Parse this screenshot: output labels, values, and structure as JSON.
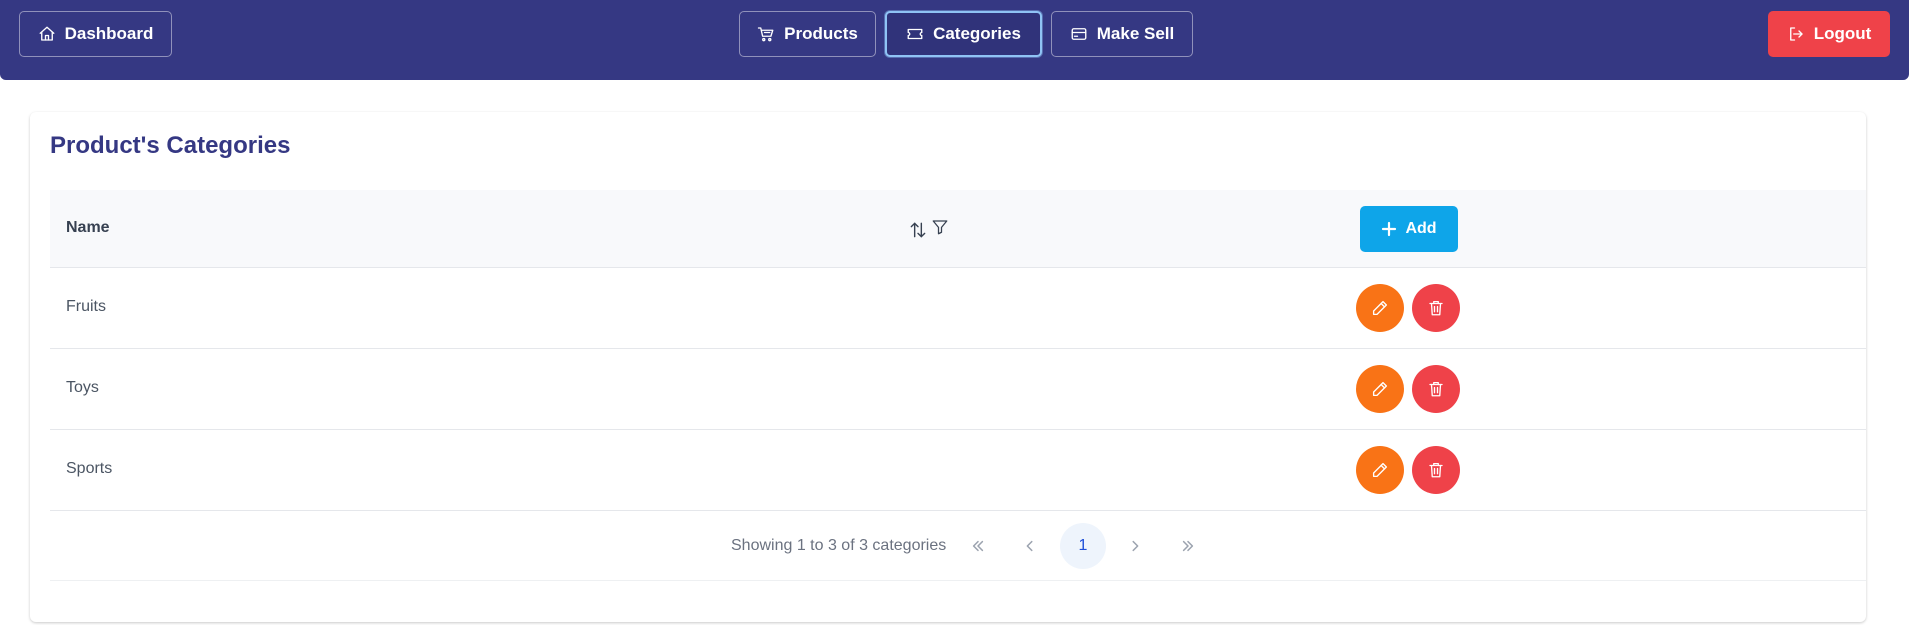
{
  "nav": {
    "dashboard_label": "Dashboard",
    "products_label": "Products",
    "categories_label": "Categories",
    "make_sell_label": "Make Sell",
    "logout_label": "Logout",
    "active_item": "Categories"
  },
  "page": {
    "title": "Product's Categories"
  },
  "table": {
    "columns": [
      "Name"
    ],
    "add_label": "Add",
    "rows": [
      {
        "name": "Fruits"
      },
      {
        "name": "Toys"
      },
      {
        "name": "Sports"
      }
    ]
  },
  "pagination": {
    "report": "Showing 1 to 3 of 3 categories",
    "current_page": "1"
  },
  "icons": {
    "dashboard": "home-icon",
    "products": "cart-icon",
    "categories": "ticket-icon",
    "make_sell": "credit-card-icon",
    "logout": "logout-icon",
    "sort": "sort-icon",
    "filter": "filter-icon",
    "add": "plus-icon",
    "edit": "pencil-icon",
    "delete": "trash-icon"
  },
  "colors": {
    "header_bg": "#353883",
    "active_border": "#8fc3f5",
    "logout": "#ef4249",
    "add": "#0ea5e9",
    "edit": "#f97316",
    "delete": "#ef4249",
    "title": "#353883"
  }
}
